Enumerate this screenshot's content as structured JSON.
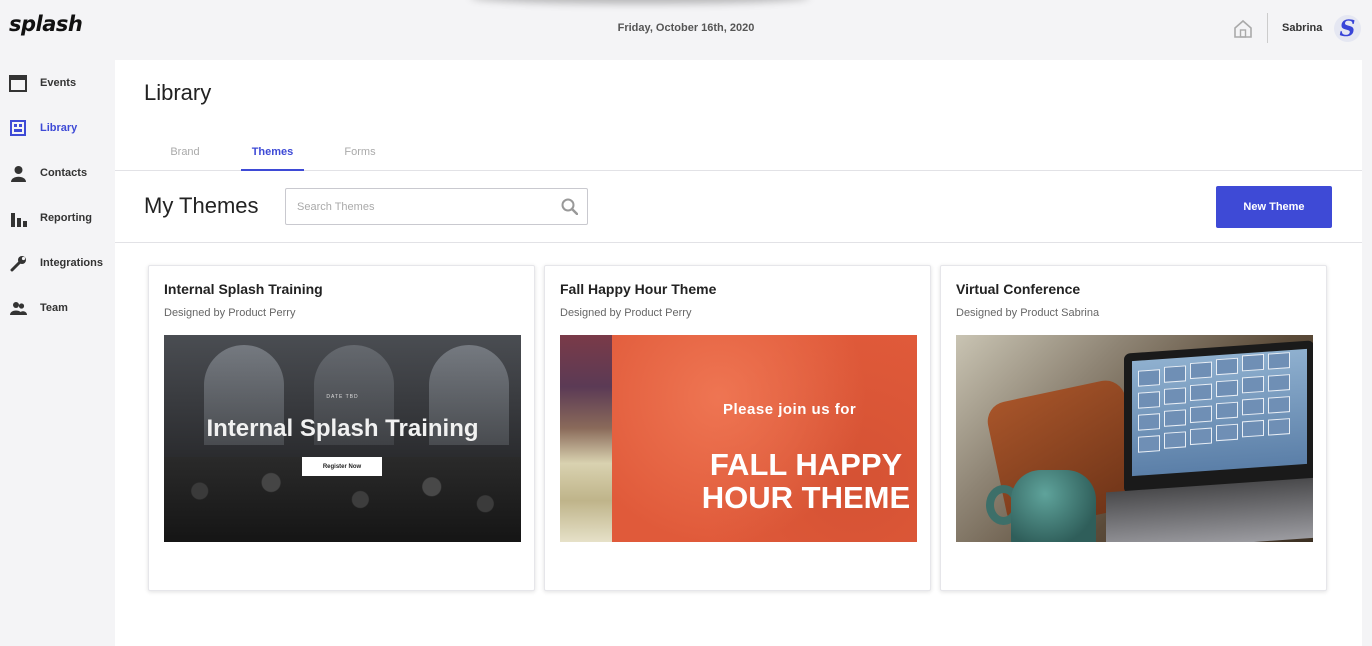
{
  "app": {
    "logo": "splash",
    "date": "Friday, October 16th, 2020"
  },
  "header": {
    "user_name": "Sabrina",
    "avatar_letter": "S",
    "home_icon": "home-icon"
  },
  "sidebar": {
    "items": [
      {
        "label": "Events",
        "icon": "calendar-icon",
        "active": false
      },
      {
        "label": "Library",
        "icon": "library-icon",
        "active": true
      },
      {
        "label": "Contacts",
        "icon": "person-icon",
        "active": false
      },
      {
        "label": "Reporting",
        "icon": "bar-chart-icon",
        "active": false
      },
      {
        "label": "Integrations",
        "icon": "wrench-icon",
        "active": false
      },
      {
        "label": "Team",
        "icon": "team-icon",
        "active": false
      }
    ]
  },
  "main": {
    "title": "Library",
    "tabs": [
      {
        "label": "Brand",
        "active": false
      },
      {
        "label": "Themes",
        "active": true
      },
      {
        "label": "Forms",
        "active": false
      }
    ],
    "section_title": "My Themes",
    "search": {
      "placeholder": "Search Themes",
      "value": ""
    },
    "new_button": "New Theme"
  },
  "themes": [
    {
      "title": "Internal Splash Training",
      "designer": "Designed by Product Perry",
      "preview": {
        "date_label": "DATE TBD",
        "heading": "Internal Splash Training",
        "button": "Register Now"
      }
    },
    {
      "title": "Fall Happy Hour Theme",
      "designer": "Designed by Product Perry",
      "preview": {
        "line1": "Please join us for",
        "line2": "FALL HAPPY",
        "line3": "HOUR THEME"
      }
    },
    {
      "title": "Virtual Conference",
      "designer": "Designed by Product Sabrina",
      "preview": {}
    }
  ],
  "colors": {
    "accent": "#3e4ad6",
    "background": "#f4f4f6",
    "panel": "#ffffff"
  }
}
